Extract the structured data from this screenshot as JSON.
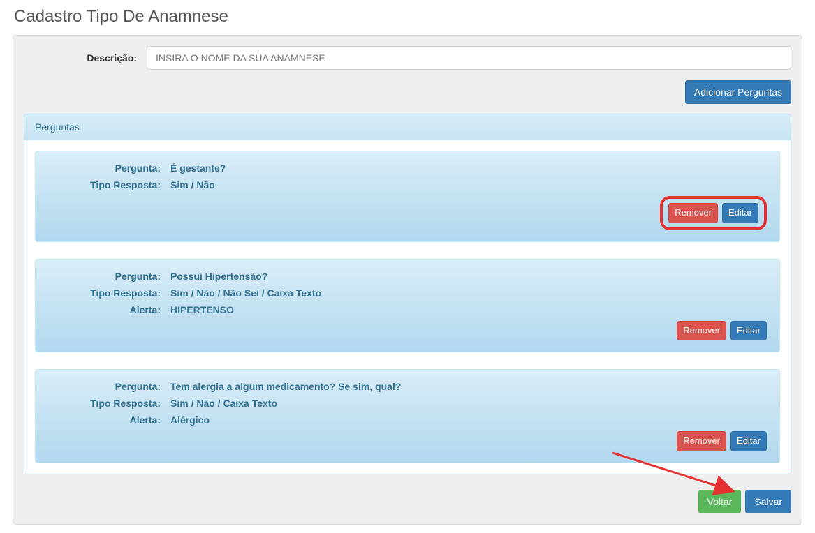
{
  "page": {
    "title": "Cadastro Tipo De Anamnese"
  },
  "form": {
    "descricao_label": "Descrição:",
    "descricao_placeholder": "INSIRA O NOME DA SUA ANAMNESE"
  },
  "buttons": {
    "adicionar_perguntas": "Adicionar Perguntas",
    "remover": "Remover",
    "editar": "Editar",
    "voltar": "Voltar",
    "salvar": "Salvar"
  },
  "panel": {
    "heading": "Perguntas"
  },
  "labels": {
    "pergunta": "Pergunta:",
    "tipo_resposta": "Tipo Resposta:",
    "alerta": "Alerta:"
  },
  "questions": [
    {
      "pergunta": "É gestante?",
      "tipo_resposta": "Sim / Não",
      "alerta": ""
    },
    {
      "pergunta": "Possui Hipertensão?",
      "tipo_resposta": "Sim / Não / Não Sei / Caixa Texto",
      "alerta": "HIPERTENSO"
    },
    {
      "pergunta": "Tem alergia a algum medicamento? Se sim, qual?",
      "tipo_resposta": "Sim / Não / Caixa Texto",
      "alerta": "Alérgico"
    }
  ]
}
